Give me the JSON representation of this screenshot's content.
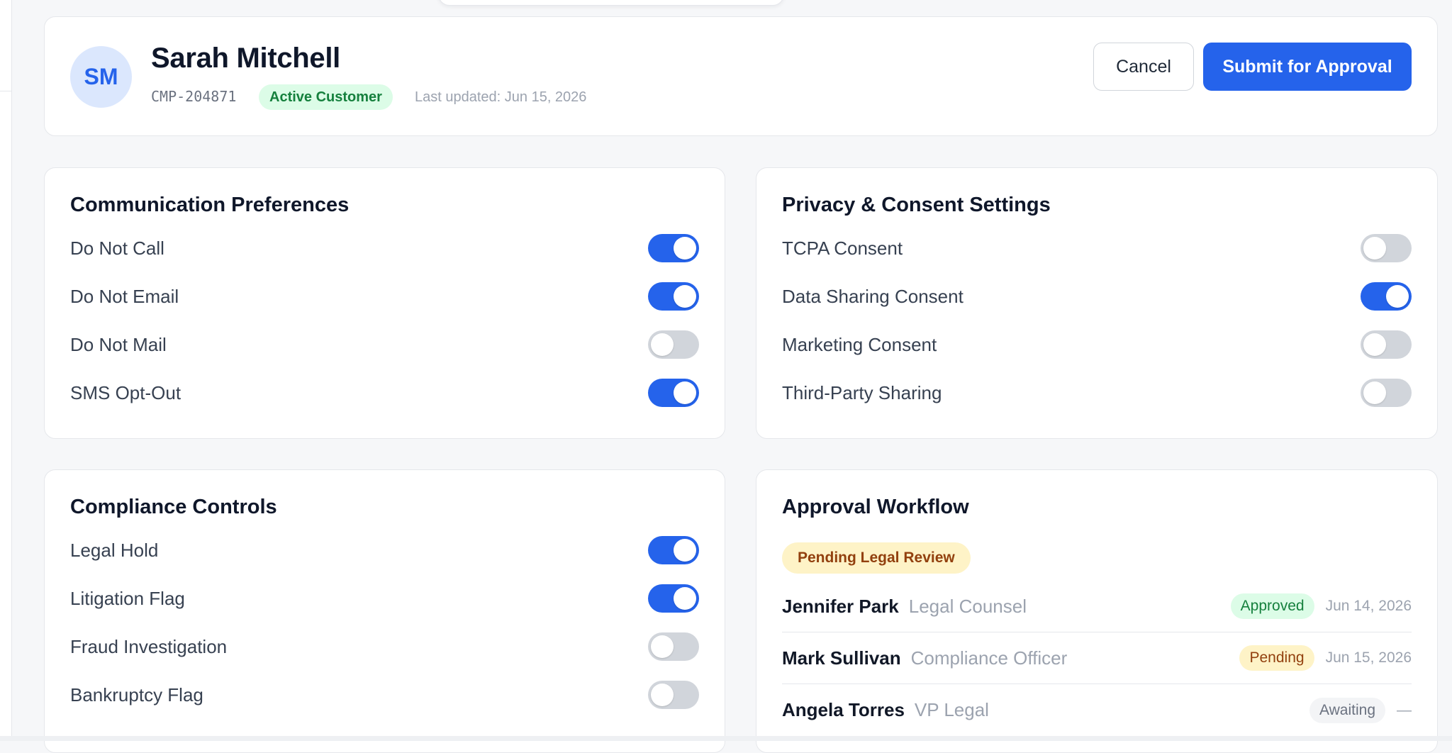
{
  "header": {
    "avatar_initials": "SM",
    "customer_name": "Sarah Mitchell",
    "customer_id": "CMP-204871",
    "status": "Active Customer",
    "last_updated": "Last updated: Jun 15, 2026",
    "cancel_label": "Cancel",
    "submit_label": "Submit for Approval"
  },
  "communication": {
    "title": "Communication Preferences",
    "items": [
      {
        "label": "Do Not Call",
        "on": true
      },
      {
        "label": "Do Not Email",
        "on": true
      },
      {
        "label": "Do Not Mail",
        "on": false
      },
      {
        "label": "SMS Opt-Out",
        "on": true
      }
    ]
  },
  "privacy": {
    "title": "Privacy & Consent Settings",
    "items": [
      {
        "label": "TCPA Consent",
        "on": false
      },
      {
        "label": "Data Sharing Consent",
        "on": true
      },
      {
        "label": "Marketing Consent",
        "on": false
      },
      {
        "label": "Third-Party Sharing",
        "on": false
      }
    ]
  },
  "compliance": {
    "title": "Compliance Controls",
    "items": [
      {
        "label": "Legal Hold",
        "on": true
      },
      {
        "label": "Litigation Flag",
        "on": true
      },
      {
        "label": "Fraud Investigation",
        "on": false
      },
      {
        "label": "Bankruptcy Flag",
        "on": false
      }
    ]
  },
  "approval": {
    "title": "Approval Workflow",
    "status": "Pending Legal Review",
    "approvers": [
      {
        "name": "Jennifer Park",
        "role": "Legal Counsel",
        "status": "Approved",
        "date": "Jun 14, 2026"
      },
      {
        "name": "Mark Sullivan",
        "role": "Compliance Officer",
        "status": "Pending",
        "date": "Jun 15, 2026"
      },
      {
        "name": "Angela Torres",
        "role": "VP Legal",
        "status": "Awaiting",
        "date": "—"
      }
    ]
  },
  "colors": {
    "accent": "#2563eb",
    "toggle_off": "#d1d5db",
    "approved": "#15803d",
    "pending": "#92400e"
  }
}
